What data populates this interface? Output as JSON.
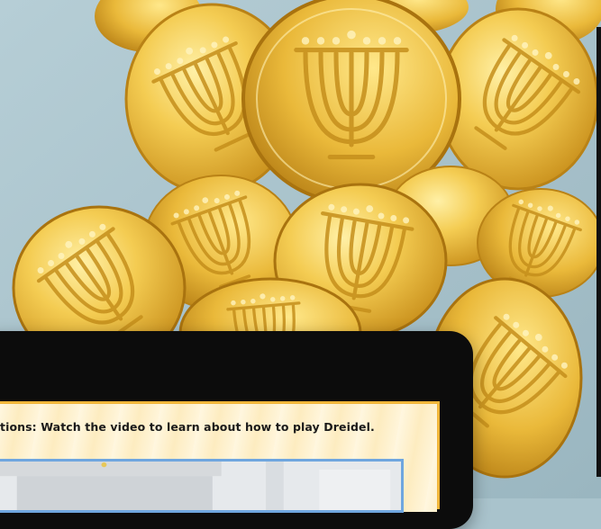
{
  "tablet": {
    "directions_text": "tions: Watch the video to learn about how to play Dreidel."
  },
  "colors": {
    "background": "#a9c3cc",
    "coin_gold": "#f2c64a",
    "tablet_bezel": "#0c0c0c",
    "worksheet_border": "#f1b63a",
    "video_border": "#6fa6df"
  }
}
